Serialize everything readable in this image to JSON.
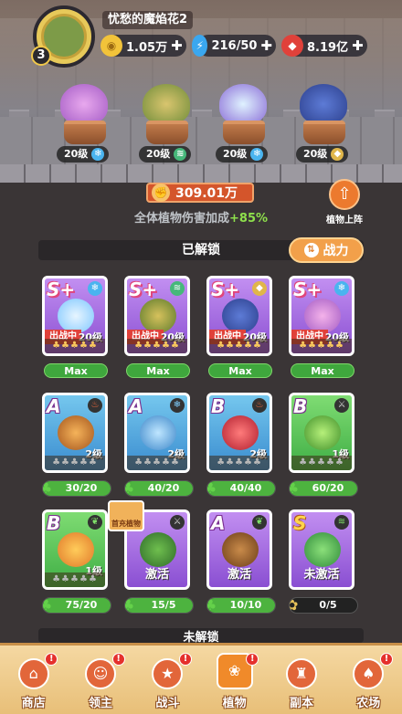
{
  "player": {
    "level": "3",
    "name": "忧愁的魔焰花2"
  },
  "resources": [
    {
      "name": "gold",
      "icon": "coin-icon",
      "value": "1.05万",
      "color": "#f2c33a"
    },
    {
      "name": "energy",
      "icon": "lightning-icon",
      "value": "216/50",
      "color": "#3aa7ef"
    },
    {
      "name": "gems",
      "icon": "ruby-icon",
      "value": "8.19亿",
      "color": "#e0413a"
    }
  ],
  "lineup": [
    {
      "level_label": "20级",
      "element": "ice",
      "element_icon": "snowflake-icon"
    },
    {
      "level_label": "20级",
      "element": "wind",
      "element_icon": "wind-icon"
    },
    {
      "level_label": "20级",
      "element": "ice",
      "element_icon": "snowflake-icon"
    },
    {
      "level_label": "20级",
      "element": "earth",
      "element_icon": "rock-icon"
    }
  ],
  "power": {
    "value": "309.01万",
    "bonus_label": "全体植物伤害加成",
    "bonus_value": "+85%"
  },
  "deploy_button": "植物上阵",
  "sections": {
    "unlocked": "已解锁",
    "locked": "未解锁"
  },
  "sort_button": "战力",
  "unlocked_row1": [
    {
      "grade": "S+",
      "element_icon": "snowflake-icon",
      "status": "出战中",
      "level": "20级",
      "stars": "♣♣♣♣♣",
      "bottom": "Max"
    },
    {
      "grade": "S+",
      "element_icon": "wind-icon",
      "status": "出战中",
      "level": "20级",
      "stars": "♣♣♣♣♣",
      "bottom": "Max"
    },
    {
      "grade": "S+",
      "element_icon": "rock-icon",
      "status": "出战中",
      "level": "20级",
      "stars": "♣♣♣♣♣",
      "bottom": "Max"
    },
    {
      "grade": "S+",
      "element_icon": "snowflake-icon",
      "status": "出战中",
      "level": "20级",
      "stars": "♣♣♣♣♣",
      "bottom": "Max"
    }
  ],
  "unlocked_row2": [
    {
      "grade": "A",
      "element_icon": "fire-icon",
      "level": "2级",
      "stars": "♣♣♣♣♣",
      "progress": "30/20",
      "fill": 1.0
    },
    {
      "grade": "A",
      "element_icon": "snowflake-icon",
      "level": "2级",
      "stars": "♣♣♣♣♣",
      "progress": "40/20",
      "fill": 1.0
    },
    {
      "grade": "B",
      "element_icon": "fire-icon",
      "level": "2级",
      "stars": "♣♣♣♣♣",
      "progress": "40/40",
      "fill": 1.0
    },
    {
      "grade": "B",
      "element_icon": "sword-icon",
      "level": "1级",
      "stars": "♣♣♣♣♣",
      "progress": "60/20",
      "fill": 1.0
    }
  ],
  "unlocked_row3": [
    {
      "grade": "B",
      "element_icon": "leaf-icon",
      "level": "1级",
      "stars": "♣♣♣♣♣",
      "center": "",
      "progress": "75/20",
      "fill": 1.0
    },
    {
      "grade": "",
      "element_icon": "sword-icon",
      "level": "",
      "stars": "",
      "center": "激活",
      "progress": "15/5",
      "fill": 1.0
    },
    {
      "grade": "A",
      "element_icon": "leaf-icon",
      "level": "",
      "stars": "",
      "center": "激活",
      "progress": "10/10",
      "fill": 1.0
    },
    {
      "grade": "S",
      "element_icon": "wind-icon",
      "level": "",
      "stars": "",
      "center": "未激活",
      "progress": "0/5",
      "fill": 0.0
    }
  ],
  "fresh_tag": "首充植物",
  "nav": [
    {
      "label": "商店",
      "icon": "shop-icon",
      "badge": "!"
    },
    {
      "label": "领主",
      "icon": "lord-icon",
      "badge": "!"
    },
    {
      "label": "战斗",
      "icon": "battle-icon",
      "badge": "!"
    },
    {
      "label": "植物",
      "icon": "plant-icon",
      "badge": "!",
      "active": true
    },
    {
      "label": "副本",
      "icon": "dungeon-icon",
      "badge": ""
    },
    {
      "label": "农场",
      "icon": "farm-icon",
      "badge": "!"
    }
  ]
}
